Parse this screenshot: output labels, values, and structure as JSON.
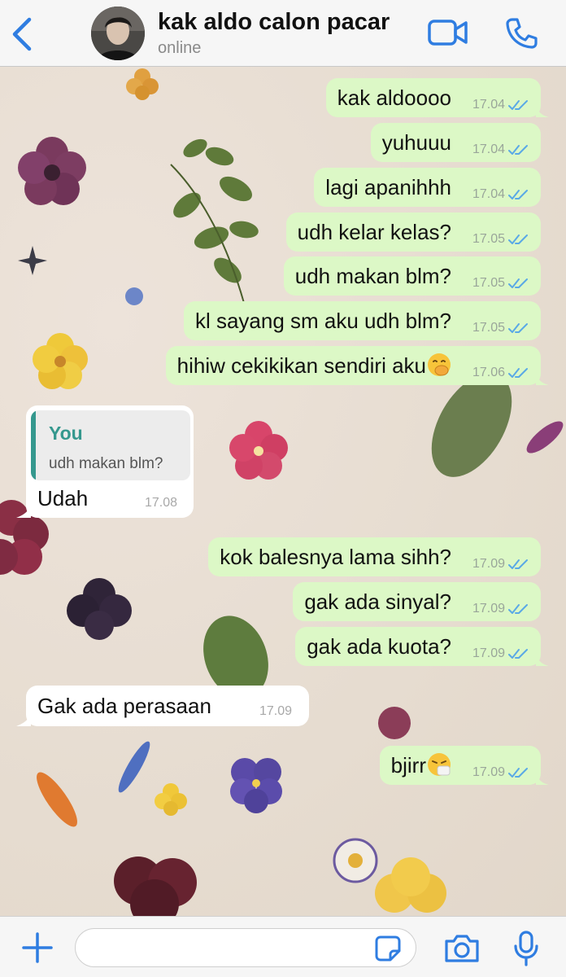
{
  "header": {
    "contact_name": "kak aldo calon pacar",
    "status": "online",
    "icons": {
      "back": "chevron-left-icon",
      "video": "video-camera-icon",
      "call": "phone-icon"
    }
  },
  "messages": [
    {
      "direction": "outgoing",
      "text": "kak aldoooo",
      "time": "17.04",
      "status": "read"
    },
    {
      "direction": "outgoing",
      "text": "yuhuuu",
      "time": "17.04",
      "status": "read"
    },
    {
      "direction": "outgoing",
      "text": "lagi apanihhh",
      "time": "17.04",
      "status": "read"
    },
    {
      "direction": "outgoing",
      "text": "udh kelar kelas?",
      "time": "17.05",
      "status": "read"
    },
    {
      "direction": "outgoing",
      "text": "udh makan blm?",
      "time": "17.05",
      "status": "read"
    },
    {
      "direction": "outgoing",
      "text": "kl sayang sm aku udh blm?",
      "time": "17.05",
      "status": "read"
    },
    {
      "direction": "outgoing",
      "text": "hihiw cekikikan sendiri aku",
      "emoji": "hand-over-mouth-emoji",
      "time": "17.06",
      "status": "read"
    },
    {
      "direction": "incoming",
      "reply_to": {
        "author": "You",
        "text": "udh makan blm?"
      },
      "text": "Udah",
      "time": "17.08"
    },
    {
      "direction": "outgoing",
      "text": "kok balesnya lama sihh?",
      "time": "17.09",
      "status": "read"
    },
    {
      "direction": "outgoing",
      "text": "gak ada sinyal?",
      "time": "17.09",
      "status": "read"
    },
    {
      "direction": "outgoing",
      "text": "gak ada kuota?",
      "time": "17.09",
      "status": "read"
    },
    {
      "direction": "incoming",
      "text": "Gak ada perasaan",
      "time": "17.09"
    },
    {
      "direction": "outgoing",
      "text": "bjirr",
      "emoji": "sneezing-face-emoji",
      "time": "17.09",
      "status": "read"
    }
  ],
  "input_bar": {
    "placeholder": "",
    "icons": {
      "attach": "plus-icon",
      "sticker": "sticker-icon",
      "camera": "camera-icon",
      "mic": "microphone-icon"
    }
  },
  "colors": {
    "outgoing_bubble": "#dcf8c6",
    "incoming_bubble": "#ffffff",
    "accent_blue": "#2f7de1",
    "read_ticks": "#5aa9e6",
    "reply_accent": "#35988e"
  }
}
